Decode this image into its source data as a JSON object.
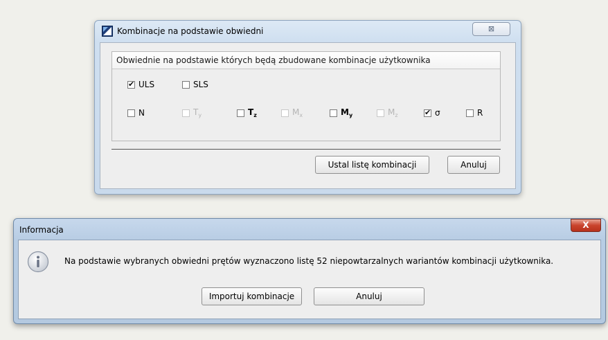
{
  "dialog1": {
    "title": "Kombinacje na podstawie obwiedni",
    "close_glyph": "⊠",
    "group_header": "Obwiednie na podstawie których będą zbudowane kombinacje użytkownika",
    "row1": [
      {
        "label": "ULS",
        "checked": true,
        "enabled": true
      },
      {
        "label": "SLS",
        "checked": false,
        "enabled": true
      }
    ],
    "row2": [
      {
        "label": "N",
        "sub": "",
        "checked": false,
        "enabled": true
      },
      {
        "label": "T",
        "sub": "y",
        "checked": false,
        "enabled": false
      },
      {
        "label": "T",
        "sub": "z",
        "checked": false,
        "enabled": true
      },
      {
        "label": "M",
        "sub": "x",
        "checked": false,
        "enabled": false
      },
      {
        "label": "M",
        "sub": "y",
        "checked": false,
        "enabled": true
      },
      {
        "label": "M",
        "sub": "z",
        "checked": false,
        "enabled": false
      },
      {
        "label": "σ",
        "sub": "",
        "checked": true,
        "enabled": true
      },
      {
        "label": "R",
        "sub": "",
        "checked": false,
        "enabled": true
      }
    ],
    "buttons": {
      "set_list": "Ustal listę kombinacji",
      "cancel": "Anuluj"
    }
  },
  "dialog2": {
    "title": "Informacja",
    "close_glyph": "X",
    "message": "Na podstawie wybranych obwiedni prętów wyznaczono listę 52 niepowtarzalnych wariantów kombinacji użytkownika.",
    "buttons": {
      "import": "Importuj kombinacje",
      "cancel": "Anuluj"
    }
  },
  "icons": {
    "app_icon": "app-logo-icon",
    "info_icon": "information-icon",
    "check_glyph": "✔"
  }
}
